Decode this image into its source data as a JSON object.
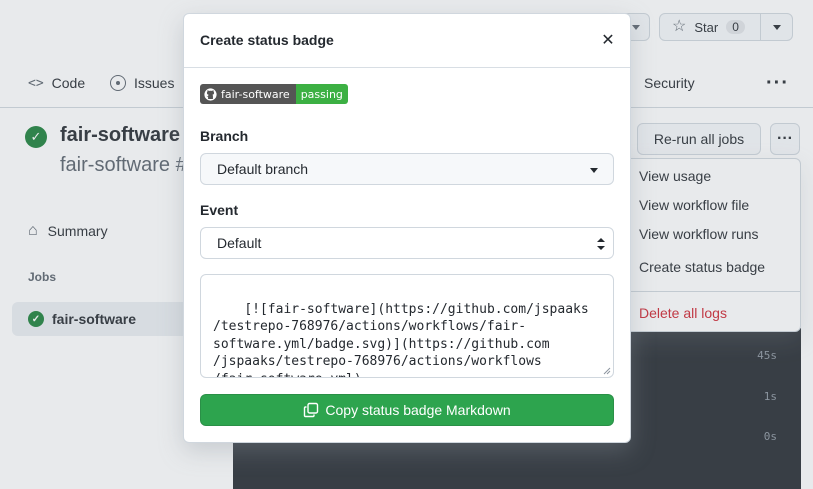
{
  "background": {
    "header": {
      "star_label": "Star",
      "star_count": "0"
    },
    "tabs": [
      {
        "label": "Code",
        "icon": "code-icon"
      },
      {
        "label": "Issues",
        "icon": "issue-opened-icon"
      },
      {
        "label": "Security",
        "icon": "shield-icon"
      }
    ],
    "run": {
      "title": "fair-software",
      "subtitle": "fair-software #"
    },
    "sidebar": {
      "summary_label": "Summary",
      "jobs_heading": "Jobs",
      "job_name": "fair-software"
    },
    "actions": {
      "rerun_label": "Re-run all jobs"
    },
    "menu": {
      "items": [
        "View usage",
        "View workflow file",
        "View workflow runs",
        "Create status badge"
      ],
      "danger_item": "Delete all logs"
    },
    "log_durations": [
      "45s",
      "1s",
      "0s"
    ]
  },
  "modal": {
    "title": "Create status badge",
    "badge": {
      "left_text": "fair-software",
      "right_text": "passing",
      "right_color": "#3cb043"
    },
    "branch": {
      "label": "Branch",
      "value": "Default branch"
    },
    "event": {
      "label": "Event",
      "value": "Default"
    },
    "markdown": "[![fair-software](https://github.com/jspaaks\n/testrepo-768976/actions/workflows/fair-\nsoftware.yml/badge.svg)](https://github.com\n/jspaaks/testrepo-768976/actions/workflows\n/fair-software.yml)",
    "copy_button_label": "Copy status badge Markdown"
  },
  "colors": {
    "success": "#2da44e",
    "danger": "#cf222e",
    "log_bg": "#24292f"
  }
}
